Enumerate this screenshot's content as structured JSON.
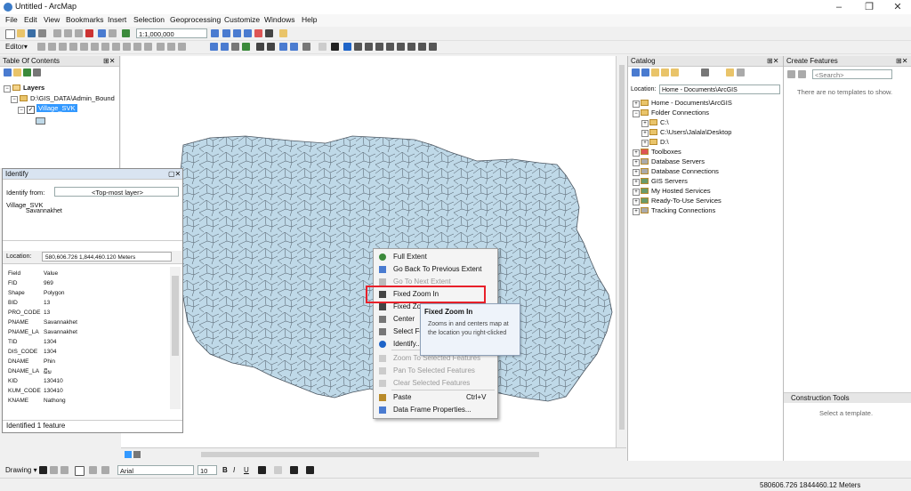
{
  "window": {
    "title": "Untitled - ArcMap",
    "min": "–",
    "max": "❐",
    "close": "✕"
  },
  "menubar": [
    "File",
    "Edit",
    "View",
    "Bookmarks",
    "Insert",
    "Selection",
    "Geoprocessing",
    "Customize",
    "Windows",
    "Help"
  ],
  "toolbar": {
    "scale": "1:1,000,000",
    "editor": "Editor▾"
  },
  "toc": {
    "title": "Table Of Contents",
    "layers": "Layers",
    "path": "D:\\GIS_DATA\\Admin_Bound",
    "layer": "Village_SVK"
  },
  "identify": {
    "title": "Identify",
    "from_label": "Identify from:",
    "from_value": "<Top-most layer>",
    "tree_root": "Village_SVK",
    "tree_child": "Savannakhet",
    "location_label": "Location:",
    "location_value": "580,606.726  1,844,460.120 Meters",
    "col_field": "Field",
    "col_value": "Value",
    "rows": [
      {
        "f": "FID",
        "v": "969"
      },
      {
        "f": "Shape",
        "v": "Polygon"
      },
      {
        "f": "BID",
        "v": "13"
      },
      {
        "f": "PRO_CODE",
        "v": "13"
      },
      {
        "f": "PNAME",
        "v": "Savannakhet"
      },
      {
        "f": "PNAME_LA",
        "v": "Savannakhet"
      },
      {
        "f": "TID",
        "v": "1304"
      },
      {
        "f": "DIS_CODE",
        "v": "1304"
      },
      {
        "f": "DNAME",
        "v": "Phin"
      },
      {
        "f": "DNAME_LA",
        "v": "ພິນ"
      },
      {
        "f": "KID",
        "v": "130410"
      },
      {
        "f": "KUM_CODE",
        "v": "130410"
      },
      {
        "f": "KNAME",
        "v": "Nathong"
      }
    ],
    "footer": "Identified 1 feature"
  },
  "context_menu": {
    "items": [
      {
        "label": "Full Extent",
        "disabled": false
      },
      {
        "label": "Go Back To Previous Extent",
        "disabled": false
      },
      {
        "label": "Go To Next Extent",
        "disabled": true
      },
      {
        "label": "Fixed Zoom In",
        "disabled": false
      },
      {
        "label": "Fixed Zoom Out",
        "disabled": false
      },
      {
        "label": "Center",
        "disabled": false
      },
      {
        "label": "Select Features",
        "disabled": false
      },
      {
        "label": "Identify...",
        "disabled": false
      },
      {
        "label": "Zoom To Selected Features",
        "disabled": true
      },
      {
        "label": "Pan To Selected Features",
        "disabled": true
      },
      {
        "label": "Clear Selected Features",
        "disabled": true
      },
      {
        "label": "Paste",
        "shortcut": "Ctrl+V",
        "disabled": false
      },
      {
        "label": "Data Frame Properties...",
        "disabled": false
      }
    ],
    "visible_labels": [
      "Full Extent",
      "Go Back To Previous Extent",
      "Go To Next Extent",
      "Fixed Zoom In",
      "Fixed Zoo",
      "Center",
      "Select Fe",
      "Identify...",
      "Zoom To Selected Features",
      "Pan To Selected Features",
      "Clear Selected Features",
      "Paste",
      "Data Frame Properties..."
    ],
    "tooltip_title": "Fixed Zoom In",
    "tooltip_body": "Zooms in and centers map at the location you right-clicked",
    "highlight_color": "#e8202a"
  },
  "catalog": {
    "title": "Catalog",
    "location_label": "Location:",
    "location_value": "Home - Documents\\ArcGIS",
    "items": [
      "Home - Documents\\ArcGIS",
      "Folder Connections",
      "C:\\",
      "C:\\Users\\Jalala\\Desktop",
      "D:\\",
      "Toolboxes",
      "Database Servers",
      "Database Connections",
      "GIS Servers",
      "My Hosted Services",
      "Ready-To-Use Services",
      "Tracking Connections"
    ]
  },
  "create_features": {
    "title": "Create Features",
    "search": "<Search>",
    "empty": "There are no templates to show.",
    "construction_title": "Construction Tools",
    "construction_empty": "Select a template."
  },
  "drawing": {
    "label": "Drawing ▾",
    "font": "Arial",
    "size": "10"
  },
  "status": {
    "coords": "580606.726  1844460.12 Meters"
  },
  "colors": {
    "map_fill": "#bfd9e8",
    "selection": "#3399ff"
  }
}
